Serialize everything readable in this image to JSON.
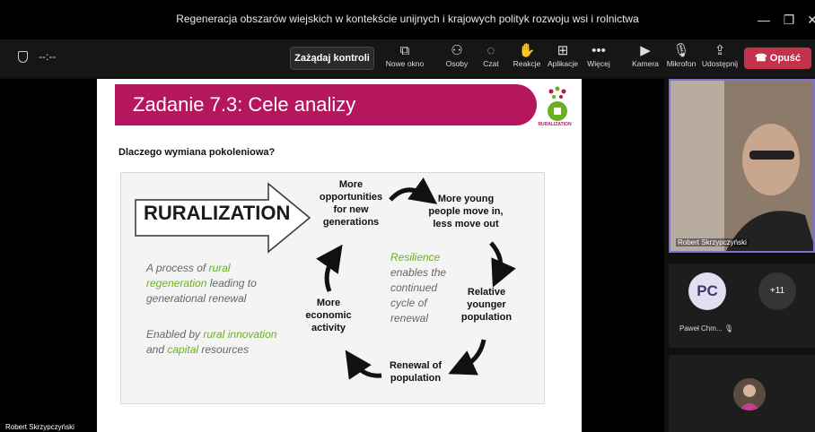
{
  "window": {
    "title": "Regeneracja obszarów wiejskich w kontekście unijnych i krajowych polityk rozwoju wsi i rolnictwa"
  },
  "toolbar": {
    "timer": "--:--",
    "request_control": "Zażądaj kontroli",
    "items": [
      {
        "label": "Nowe okno",
        "icon": "new-window-icon"
      },
      {
        "label": "Osoby",
        "icon": "people-icon"
      },
      {
        "label": "Czat",
        "icon": "chat-icon"
      },
      {
        "label": "Reakcje",
        "icon": "reactions-icon"
      },
      {
        "label": "Aplikacje",
        "icon": "apps-icon"
      },
      {
        "label": "Więcej",
        "icon": "more-icon"
      },
      {
        "label": "Kamera",
        "icon": "camera-off-icon"
      },
      {
        "label": "Mikrofon",
        "icon": "mic-off-icon"
      },
      {
        "label": "Udostępnij",
        "icon": "share-icon"
      }
    ],
    "leave": "Opuść",
    "leave_color": "#c4314b"
  },
  "slide": {
    "title": "Zadanie 7.3: Cele analizy",
    "logo_text": "RURALIZATION",
    "question": "Dlaczego wymiana pokoleniowa?",
    "arrow_text": "RURALIZATION",
    "desc1_a": "A process of ",
    "desc1_b": "rural",
    "desc1_c": "regeneration",
    "desc1_d": " leading to",
    "desc1_e": "generational renewal",
    "desc2_a": "Enabled by ",
    "desc2_b": "rural innovation",
    "desc2_c": "and ",
    "desc2_d": "capital",
    "desc2_e": " resources",
    "cycle": {
      "n1": "More opportunities for new generations",
      "n2": "More young people move in, less move out",
      "n3": "Relative younger population",
      "n4": "Renewal of population",
      "n5": "More economic activity"
    },
    "resilience_a": "Resilience",
    "resilience_b": "enables the",
    "resilience_c": "continued",
    "resilience_d": "cycle of",
    "resilience_e": "renewal",
    "accent": "#b5175f",
    "green": "#6ab023"
  },
  "stage": {
    "presenter_name": "Robert Skrzypczyński"
  },
  "participants": {
    "video_name": "Robert Skrzypczyński",
    "initials": "PC",
    "name2": "Paweł Chm...",
    "more_count": "+11"
  }
}
